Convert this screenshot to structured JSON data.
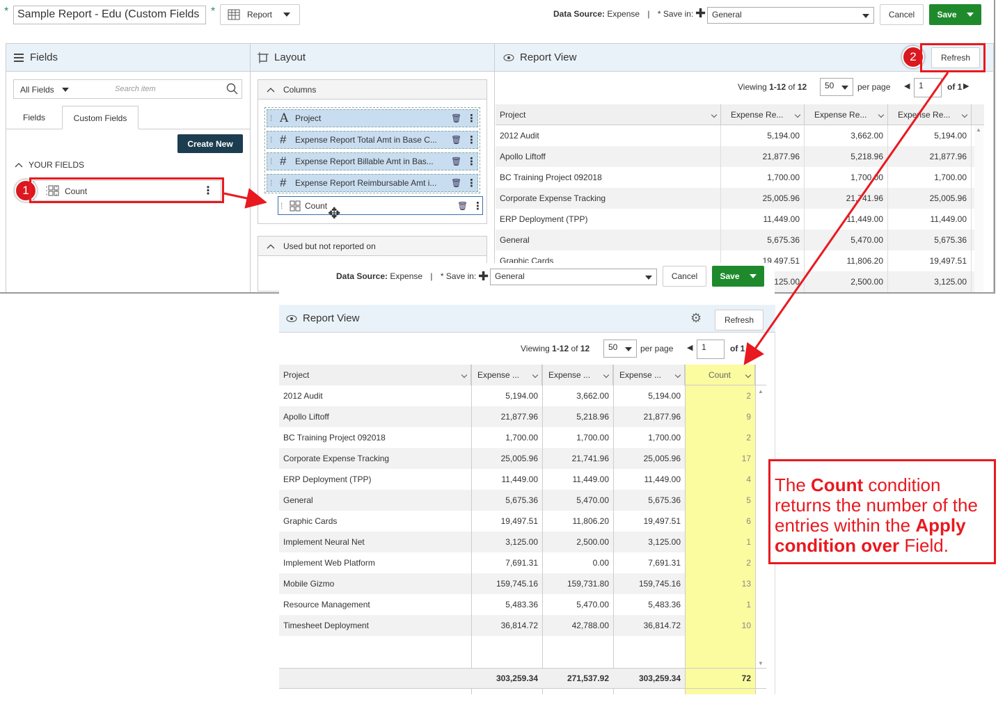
{
  "top": {
    "star": "*",
    "report_title": "Sample Report - Edu (Custom Fields",
    "report_type": "Report",
    "data_source_label": "Data Source:",
    "data_source_value": "Expense",
    "separator": "|",
    "save_in_label": "* Save in:",
    "save_in_value": "General",
    "cancel_label": "Cancel",
    "save_label": "Save"
  },
  "fields_panel": {
    "title": "Fields",
    "filter_value": "All Fields",
    "search_placeholder": "Search item",
    "tabs": [
      "Fields",
      "Custom Fields"
    ],
    "create_new_label": "Create New",
    "section_title": "YOUR FIELDS",
    "item_label": "Count"
  },
  "layout_panel": {
    "title": "Layout",
    "columns_title": "Columns",
    "columns": [
      "Project",
      "Expense Report Total Amt in Base C...",
      "Expense Report Billable Amt in Bas...",
      "Expense Report Reimbursable Amt i...",
      "Count"
    ],
    "unused_title": "Used but not reported on"
  },
  "report_view_top": {
    "title": "Report View",
    "refresh_label": "Refresh",
    "viewing_prefix": "Viewing ",
    "viewing_range": "1-12",
    "viewing_of": " of ",
    "viewing_total": "12",
    "per_page_value": "50",
    "per_page_label": "per page",
    "page_value": "1",
    "page_of": "of 1",
    "headers": [
      "Project",
      "Expense Re...",
      "Expense Re...",
      "Expense Re..."
    ],
    "rows": [
      [
        "2012 Audit",
        "5,194.00",
        "3,662.00",
        "5,194.00"
      ],
      [
        "Apollo Liftoff",
        "21,877.96",
        "5,218.96",
        "21,877.96"
      ],
      [
        "BC Training Project 092018",
        "1,700.00",
        "1,700.00",
        "1,700.00"
      ],
      [
        "Corporate Expense Tracking",
        "25,005.96",
        "21,741.96",
        "25,005.96"
      ],
      [
        "ERP Deployment (TPP)",
        "11,449.00",
        "11,449.00",
        "11,449.00"
      ],
      [
        "General",
        "5,675.36",
        "5,470.00",
        "5,675.36"
      ],
      [
        "Graphic Cards",
        "19,497.51",
        "11,806.20",
        "19,497.51"
      ],
      [
        "",
        "3,125.00",
        "2,500.00",
        "3,125.00"
      ]
    ]
  },
  "bottom_bar": {
    "data_source_label": "Data Source:",
    "data_source_value": "Expense",
    "separator": "|",
    "save_in_label": "* Save in:",
    "save_in_value": "General",
    "cancel_label": "Cancel",
    "save_label": "Save"
  },
  "report_view_bottom": {
    "title": "Report View",
    "refresh_label": "Refresh",
    "viewing_prefix": "Viewing ",
    "viewing_range": "1-12",
    "viewing_of": " of ",
    "viewing_total": "12",
    "per_page_value": "50",
    "per_page_label": "per page",
    "page_value": "1",
    "page_of": "of 1",
    "headers": [
      "Project",
      "Expense ...",
      "Expense ...",
      "Expense ...",
      "Count"
    ],
    "rows": [
      [
        "2012 Audit",
        "5,194.00",
        "3,662.00",
        "5,194.00",
        "2"
      ],
      [
        "Apollo Liftoff",
        "21,877.96",
        "5,218.96",
        "21,877.96",
        "9"
      ],
      [
        "BC Training Project 092018",
        "1,700.00",
        "1,700.00",
        "1,700.00",
        "2"
      ],
      [
        "Corporate Expense Tracking",
        "25,005.96",
        "21,741.96",
        "25,005.96",
        "17"
      ],
      [
        "ERP Deployment (TPP)",
        "11,449.00",
        "11,449.00",
        "11,449.00",
        "4"
      ],
      [
        "General",
        "5,675.36",
        "5,470.00",
        "5,675.36",
        "5"
      ],
      [
        "Graphic Cards",
        "19,497.51",
        "11,806.20",
        "19,497.51",
        "6"
      ],
      [
        "Implement Neural Net",
        "3,125.00",
        "2,500.00",
        "3,125.00",
        "1"
      ],
      [
        "Implement Web Platform",
        "7,691.31",
        "0.00",
        "7,691.31",
        "2"
      ],
      [
        "Mobile Gizmo",
        "159,745.16",
        "159,731.80",
        "159,745.16",
        "13"
      ],
      [
        "Resource Management",
        "5,483.36",
        "5,470.00",
        "5,483.36",
        "1"
      ],
      [
        "Timesheet Deployment",
        "36,814.72",
        "42,788.00",
        "36,814.72",
        "10"
      ]
    ],
    "totals": [
      "303,259.34",
      "271,537.92",
      "303,259.34",
      "72"
    ]
  },
  "annotations": {
    "step1": "1",
    "step2": "2",
    "note_parts": [
      "The ",
      "Count",
      " condition returns the number of the entries within the ",
      "Apply condition over",
      " Field."
    ]
  },
  "colors": {
    "accent_red": "#e8191f",
    "save_green": "#1e8a2c",
    "highlight_yellow": "#fbfba0",
    "header_blue": "#eaf2f9"
  }
}
